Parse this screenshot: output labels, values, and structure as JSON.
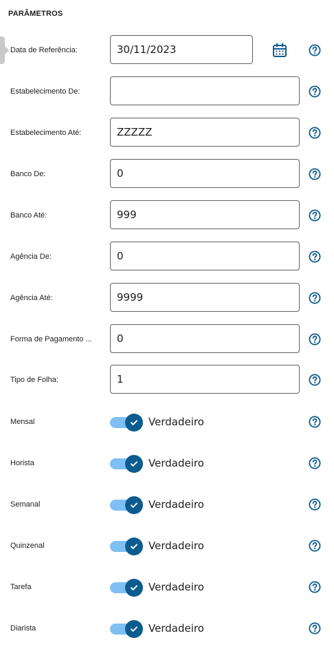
{
  "section_title": "PARÂMETROS",
  "accent_color": "#0c5c8f",
  "toggle_track_color": "#7ec0f3",
  "icons": {
    "help": "help-circle-icon",
    "calendar": "calendar-icon",
    "check": "check-icon"
  },
  "fields": [
    {
      "label": "Data de Referência:",
      "value": "30/11/2023"
    },
    {
      "label": "Estabelecimento De:",
      "value": ""
    },
    {
      "label": "Estabelecimento Até:",
      "value": "ZZZZZ"
    },
    {
      "label": "Banco De:",
      "value": "0"
    },
    {
      "label": "Banco Até:",
      "value": "999"
    },
    {
      "label": "Agência De:",
      "value": "0"
    },
    {
      "label": "Agência Até:",
      "value": "9999"
    },
    {
      "label": "Forma de Pagamento ...",
      "value": "0"
    },
    {
      "label": "Tipo de Folha:",
      "value": "1"
    }
  ],
  "toggles": [
    {
      "label": "Mensal",
      "state": "Verdadeiro"
    },
    {
      "label": "Horista",
      "state": "Verdadeiro"
    },
    {
      "label": "Semanal",
      "state": "Verdadeiro"
    },
    {
      "label": "Quinzenal",
      "state": "Verdadeiro"
    },
    {
      "label": "Tarefa",
      "state": "Verdadeiro"
    },
    {
      "label": "Diarista",
      "state": "Verdadeiro"
    }
  ]
}
